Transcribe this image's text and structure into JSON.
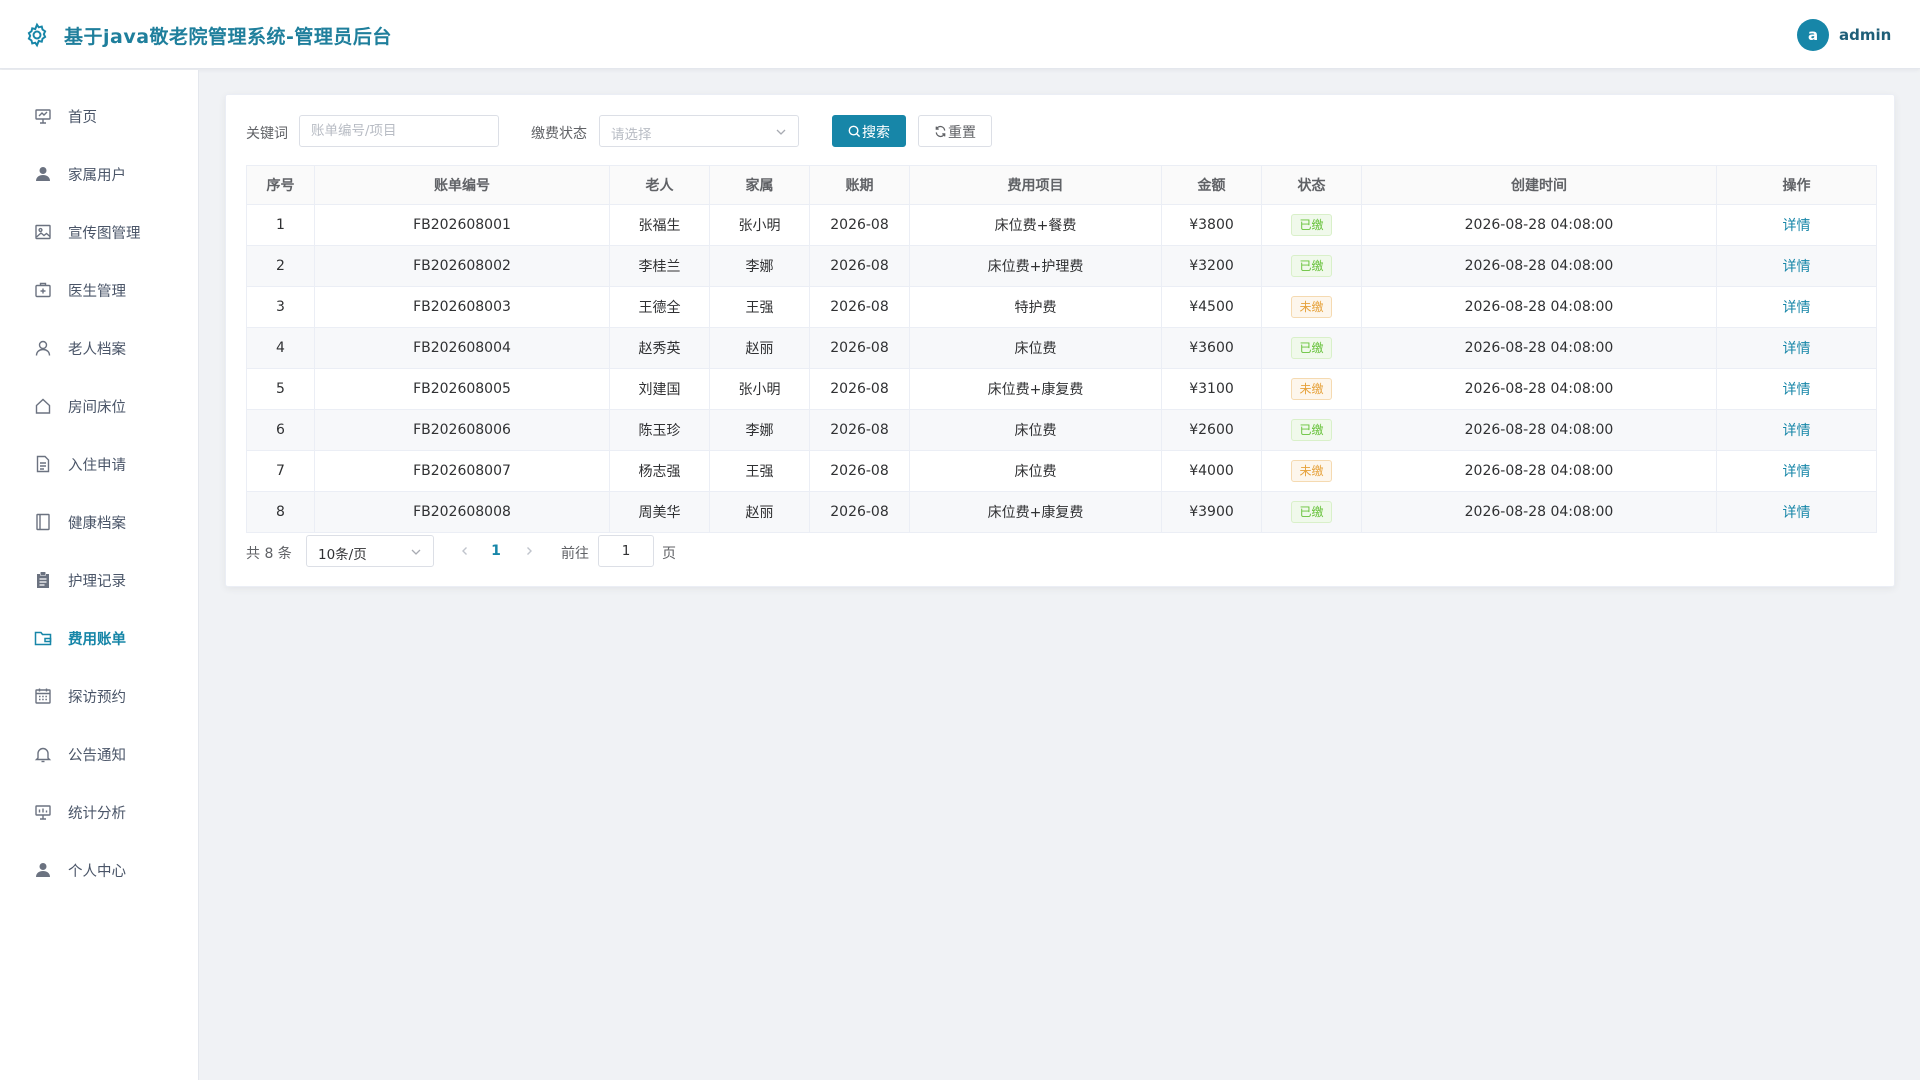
{
  "header": {
    "title": "基于java敬老院管理系统-管理员后台",
    "avatar_letter": "a",
    "username": "admin"
  },
  "sidebar": {
    "items": [
      {
        "label": "首页",
        "icon": "presentation-board-icon"
      },
      {
        "label": "家属用户",
        "icon": "user-filled-icon"
      },
      {
        "label": "宣传图管理",
        "icon": "picture-icon"
      },
      {
        "label": "医生管理",
        "icon": "first-aid-kit-icon"
      },
      {
        "label": "老人档案",
        "icon": "user-outline-icon"
      },
      {
        "label": "房间床位",
        "icon": "house-icon"
      },
      {
        "label": "入住申请",
        "icon": "document-icon"
      },
      {
        "label": "健康档案",
        "icon": "notebook-icon"
      },
      {
        "label": "护理记录",
        "icon": "clipboard-icon"
      },
      {
        "label": "费用账单",
        "icon": "wallet-folder-icon",
        "active": true
      },
      {
        "label": "探访预约",
        "icon": "calendar-icon"
      },
      {
        "label": "公告通知",
        "icon": "bell-icon"
      },
      {
        "label": "统计分析",
        "icon": "data-board-icon"
      },
      {
        "label": "个人中心",
        "icon": "user-filled-icon"
      }
    ]
  },
  "filters": {
    "keyword_label": "关键词",
    "keyword_placeholder": "账单编号/项目",
    "keyword_value": "",
    "status_label": "缴费状态",
    "status_placeholder": "请选择",
    "search_label": "搜索",
    "reset_label": "重置"
  },
  "table": {
    "columns": [
      "序号",
      "账单编号",
      "老人",
      "家属",
      "账期",
      "费用项目",
      "金额",
      "状态",
      "创建时间",
      "操作"
    ],
    "rows": [
      {
        "index": "1",
        "bill_no": "FB202608001",
        "elder": "张福生",
        "family": "张小明",
        "period": "2026-08",
        "item": "床位费+餐费",
        "amount": "¥3800",
        "status": "已缴",
        "status_type": "paid",
        "created": "2026-08-28 04:08:00",
        "action": "详情"
      },
      {
        "index": "2",
        "bill_no": "FB202608002",
        "elder": "李桂兰",
        "family": "李娜",
        "period": "2026-08",
        "item": "床位费+护理费",
        "amount": "¥3200",
        "status": "已缴",
        "status_type": "paid",
        "created": "2026-08-28 04:08:00",
        "action": "详情"
      },
      {
        "index": "3",
        "bill_no": "FB202608003",
        "elder": "王德全",
        "family": "王强",
        "period": "2026-08",
        "item": "特护费",
        "amount": "¥4500",
        "status": "未缴",
        "status_type": "unpaid",
        "created": "2026-08-28 04:08:00",
        "action": "详情"
      },
      {
        "index": "4",
        "bill_no": "FB202608004",
        "elder": "赵秀英",
        "family": "赵丽",
        "period": "2026-08",
        "item": "床位费",
        "amount": "¥3600",
        "status": "已缴",
        "status_type": "paid",
        "created": "2026-08-28 04:08:00",
        "action": "详情"
      },
      {
        "index": "5",
        "bill_no": "FB202608005",
        "elder": "刘建国",
        "family": "张小明",
        "period": "2026-08",
        "item": "床位费+康复费",
        "amount": "¥3100",
        "status": "未缴",
        "status_type": "unpaid",
        "created": "2026-08-28 04:08:00",
        "action": "详情"
      },
      {
        "index": "6",
        "bill_no": "FB202608006",
        "elder": "陈玉珍",
        "family": "李娜",
        "period": "2026-08",
        "item": "床位费",
        "amount": "¥2600",
        "status": "已缴",
        "status_type": "paid",
        "created": "2026-08-28 04:08:00",
        "action": "详情"
      },
      {
        "index": "7",
        "bill_no": "FB202608007",
        "elder": "杨志强",
        "family": "王强",
        "period": "2026-08",
        "item": "床位费",
        "amount": "¥4000",
        "status": "未缴",
        "status_type": "unpaid",
        "created": "2026-08-28 04:08:00",
        "action": "详情"
      },
      {
        "index": "8",
        "bill_no": "FB202608008",
        "elder": "周美华",
        "family": "赵丽",
        "period": "2026-08",
        "item": "床位费+康复费",
        "amount": "¥3900",
        "status": "已缴",
        "status_type": "paid",
        "created": "2026-08-28 04:08:00",
        "action": "详情"
      }
    ]
  },
  "pagination": {
    "total_text": "共 8 条",
    "page_size": "10条/页",
    "current_page": "1",
    "goto_label": "前往",
    "goto_value": "1",
    "page_unit": "页"
  },
  "colors": {
    "primary": "#1786a8",
    "paid": "#67c23a",
    "unpaid": "#e6a23c"
  }
}
